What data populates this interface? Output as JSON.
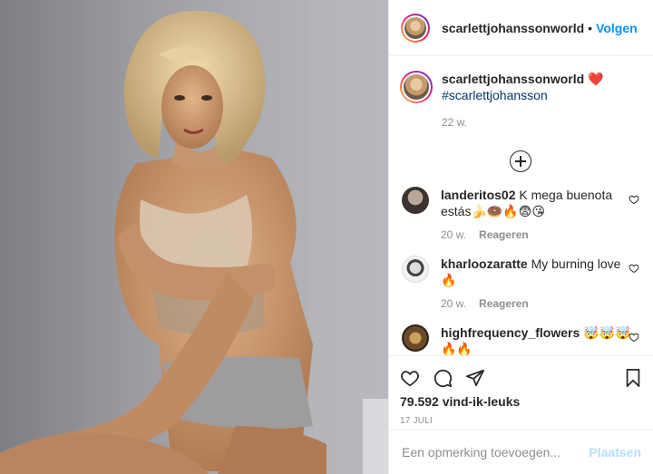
{
  "post": {
    "image_alt": "",
    "header": {
      "username": "scarlettjohanssonworld",
      "separator": "•",
      "follow_label": "Volgen"
    },
    "caption": {
      "username": "scarlettjohanssonworld",
      "text": "❤️",
      "hashtag": "#scarlettjohansson",
      "time": "22 w."
    },
    "comments": [
      {
        "username": "landeritos02",
        "text": "K mega buenota estás🍌🍩🔥😨😘",
        "time": "20 w.",
        "reply_label": "Reageren"
      },
      {
        "username": "kharloozaratte",
        "text": "My burning love🔥",
        "time": "20 w.",
        "reply_label": "Reageren"
      },
      {
        "username": "highfrequency_flowers",
        "text": "🤯🤯🤯🔥🔥",
        "time": "",
        "reply_label": ""
      }
    ],
    "likes": "79.592 vind-ik-leuks",
    "date": "17 JULI",
    "add_comment": {
      "placeholder": "Een opmerking toevoegen...",
      "post_label": "Plaatsen"
    }
  },
  "colors": {
    "link_blue": "#0095f6",
    "post_disabled": "#b2dffc",
    "muted": "#8e8e8e",
    "text": "#262626"
  }
}
